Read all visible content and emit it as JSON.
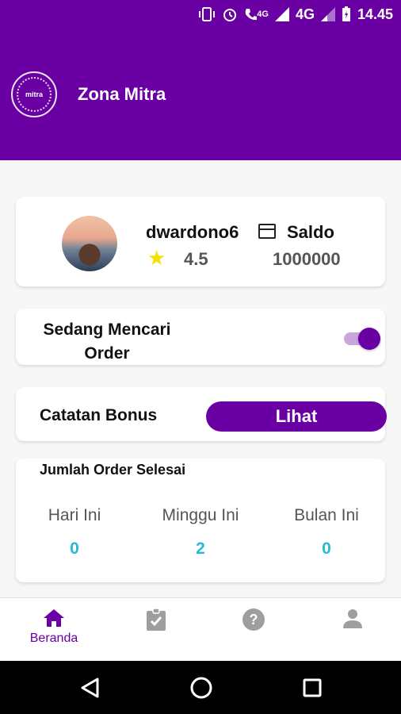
{
  "status_bar": {
    "network_small": "4G",
    "network_large": "4G",
    "time": "14.45"
  },
  "header": {
    "logo_text": "mitra",
    "title": "Zona Mitra"
  },
  "profile": {
    "username": "dwardono6",
    "rating": "4.5",
    "saldo_label": "Saldo",
    "saldo_value": "1000000"
  },
  "order_toggle": {
    "label": "Sedang Mencari Order",
    "on": true
  },
  "bonus": {
    "label": "Catatan Bonus",
    "button_label": "Lihat"
  },
  "orders": {
    "title": "Jumlah Order Selesai",
    "stats": [
      {
        "label": "Hari Ini",
        "value": "0"
      },
      {
        "label": "Minggu Ini",
        "value": "2"
      },
      {
        "label": "Bulan Ini",
        "value": "0"
      }
    ]
  },
  "bottom_nav": {
    "items": [
      {
        "icon": "home-icon",
        "label": "Beranda",
        "active": true
      },
      {
        "icon": "clipboard-check-icon",
        "label": ""
      },
      {
        "icon": "help-icon",
        "label": ""
      },
      {
        "icon": "person-icon",
        "label": ""
      }
    ]
  },
  "colors": {
    "brand": "#6a00a3",
    "accent_value": "#26bad3",
    "star": "#f6e000"
  }
}
